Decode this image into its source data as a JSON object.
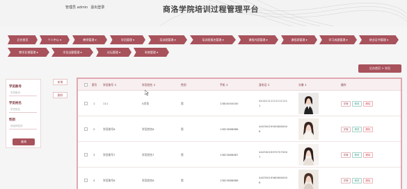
{
  "header": {
    "admin_label": "管理员 admin",
    "logout_label": "退出登录",
    "title": "商洛学院培训过程管理平台"
  },
  "nav": {
    "items": [
      {
        "label": "后台首页"
      },
      {
        "label": "个人中心 ▾"
      },
      {
        "label": "教师管理 ▾"
      },
      {
        "label": "学员管理 ▾"
      },
      {
        "label": "培训班管理 ▾"
      },
      {
        "label": "培训班报名管理 ▾"
      },
      {
        "label": "课程内容管理 ▾"
      },
      {
        "label": "课程表管理 ▾"
      },
      {
        "label": "学习成绩管理 ▾"
      },
      {
        "label": "结业证书管理 ▾"
      },
      {
        "label": "教学反馈管理 ▾"
      },
      {
        "label": "学员出勤管理 ▾"
      },
      {
        "label": "论坛管理 ▾"
      },
      {
        "label": "系统管理 ▾"
      }
    ]
  },
  "breadcrumb": "后台首页 > 学员",
  "search": {
    "fields": [
      {
        "label": "学员账号",
        "placeholder": "学员账号"
      },
      {
        "label": "学员姓名",
        "placeholder": "学员姓名"
      },
      {
        "label": "性别",
        "placeholder": "请选择性别"
      }
    ],
    "search_label": "查询"
  },
  "actions": {
    "add_label": "新增",
    "delete_label": "删除"
  },
  "table": {
    "headers": [
      "索引",
      "学员账号 ⇕",
      "学员姓名 ⇕",
      "性别",
      "手机 ⇕",
      "身份证 ⇕",
      "头像 ⇕",
      "操作"
    ],
    "rows": [
      {
        "index": "1",
        "account": "111",
        "name": "A学员",
        "gender": "男",
        "phone": "13800000000",
        "id_card": "441411111111111111",
        "photo_icon": "female-photo"
      },
      {
        "index": "2",
        "account": "学员账号8",
        "name": "学员姓名8",
        "gender": "男",
        "phone": "13823888888",
        "id_card": "440300199008080006",
        "photo_icon": "female-photo"
      },
      {
        "index": "3",
        "account": "学员账号7",
        "name": "学员姓名7",
        "gender": "男",
        "phone": "13823888887",
        "id_card": "440300199707070007",
        "photo_icon": "female-photo"
      },
      {
        "index": "4",
        "account": "学员账号6",
        "name": "学员姓名6",
        "gender": "男",
        "phone": "13823888886",
        "id_card": "440300199606060006",
        "photo_icon": "female-photo"
      }
    ],
    "row_actions": {
      "detail": "详情",
      "edit": "修改",
      "delete": "删除"
    }
  },
  "colors": {
    "accent": "#a8525c",
    "border": "#e0a8b0"
  }
}
